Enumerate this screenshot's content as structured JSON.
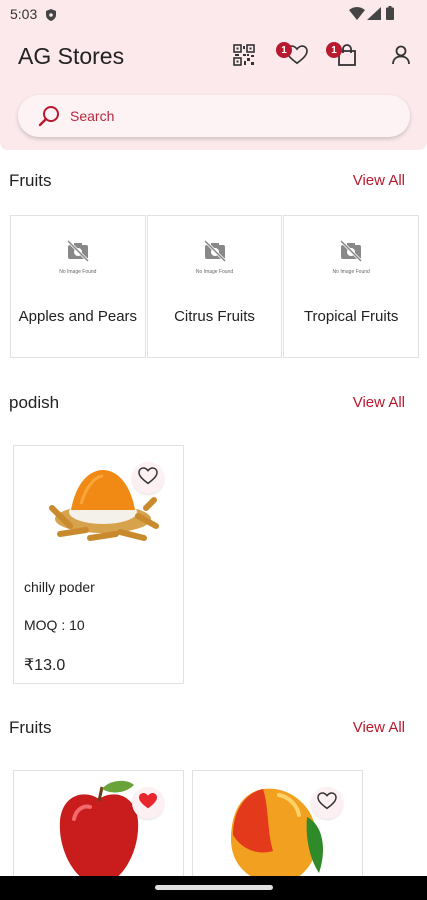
{
  "status": {
    "time": "5:03"
  },
  "app": {
    "title": "AG Stores"
  },
  "header": {
    "wishlist_count": "1",
    "cart_count": "1"
  },
  "search": {
    "placeholder": "Search"
  },
  "sections": [
    {
      "title": "Fruits",
      "view_all": "View All",
      "categories": [
        {
          "name": "Apples and Pears",
          "image_text": "No Image Found"
        },
        {
          "name": "Citrus Fruits",
          "image_text": "No Image Found"
        },
        {
          "name": "Tropical Fruits",
          "image_text": "No Image Found"
        }
      ]
    },
    {
      "title": "podish",
      "view_all": "View All",
      "products": [
        {
          "name": "chilly poder",
          "moq": "MOQ : 10",
          "price": "₹13.0",
          "favorited": false,
          "image": "turmeric-powder"
        }
      ]
    },
    {
      "title": "Fruits",
      "view_all": "View All",
      "products": [
        {
          "image": "red-apple",
          "favorited": true
        },
        {
          "image": "mango",
          "favorited": false
        }
      ]
    }
  ],
  "colors": {
    "accent": "#b8192e",
    "header_bg": "#fbe9ec",
    "search_bg": "#fdf3f5"
  }
}
